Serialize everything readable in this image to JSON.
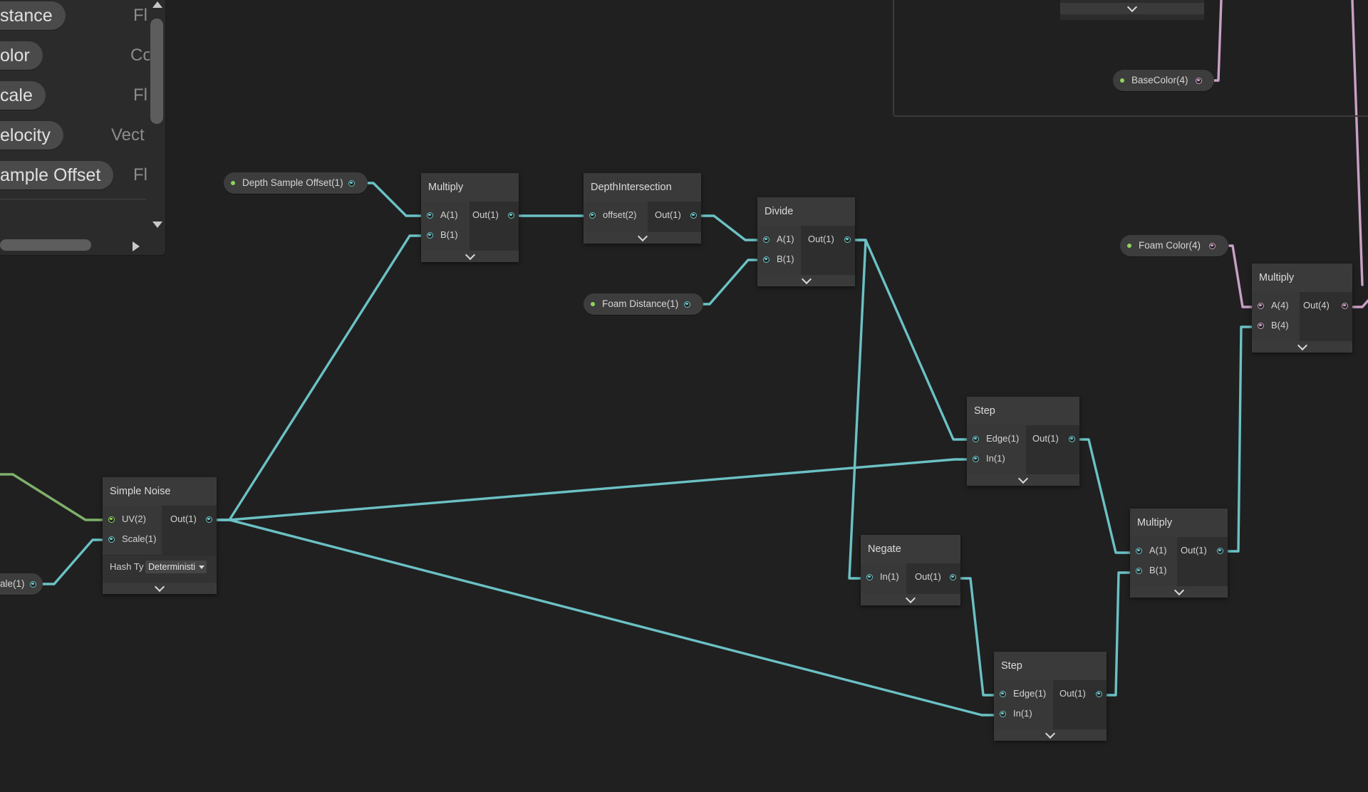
{
  "blackboard": {
    "properties": [
      {
        "name": "stance",
        "type": "Fl"
      },
      {
        "name": "olor",
        "type": "Co"
      },
      {
        "name": "cale",
        "type": "Fl"
      },
      {
        "name": "elocity",
        "type": "Vect"
      },
      {
        "name": "ample Offset",
        "type": "Fl"
      }
    ]
  },
  "graph_properties": {
    "depth_sample_offset": "Depth Sample Offset(1)",
    "foam_distance": "Foam Distance(1)",
    "foam_color": "Foam Color(4)",
    "base_color": "BaseColor(4)",
    "scale_partial": "ale(1)"
  },
  "nodes": {
    "multiply1": {
      "title": "Multiply",
      "in": [
        "A(1)",
        "B(1)"
      ],
      "out": [
        "Out(1)"
      ]
    },
    "depth_intersection": {
      "title": "DepthIntersection",
      "in": [
        "offset(2)"
      ],
      "out": [
        "Out(1)"
      ]
    },
    "divide": {
      "title": "Divide",
      "in": [
        "A(1)",
        "B(1)"
      ],
      "out": [
        "Out(1)"
      ]
    },
    "step1": {
      "title": "Step",
      "in": [
        "Edge(1)",
        "In(1)"
      ],
      "out": [
        "Out(1)"
      ]
    },
    "simple_noise": {
      "title": "Simple Noise",
      "in": [
        "UV(2)",
        "Scale(1)"
      ],
      "out": [
        "Out(1)"
      ],
      "hash_label": "Hash Ty",
      "hash_value": "Deterministi"
    },
    "negate": {
      "title": "Negate",
      "in": [
        "In(1)"
      ],
      "out": [
        "Out(1)"
      ]
    },
    "step2": {
      "title": "Step",
      "in": [
        "Edge(1)",
        "In(1)"
      ],
      "out": [
        "Out(1)"
      ]
    },
    "multiply2": {
      "title": "Multiply",
      "in": [
        "A(1)",
        "B(1)"
      ],
      "out": [
        "Out(1)"
      ]
    },
    "multiply3": {
      "title": "Multiply",
      "in": [
        "A(4)",
        "B(4)"
      ],
      "out": [
        "Out(4)"
      ]
    }
  },
  "colors": {
    "float_wire": "#6bc1c5",
    "vector4_wire": "#c9a0c4",
    "vector2_wire": "#7fb06a",
    "canvas": "#202020"
  }
}
